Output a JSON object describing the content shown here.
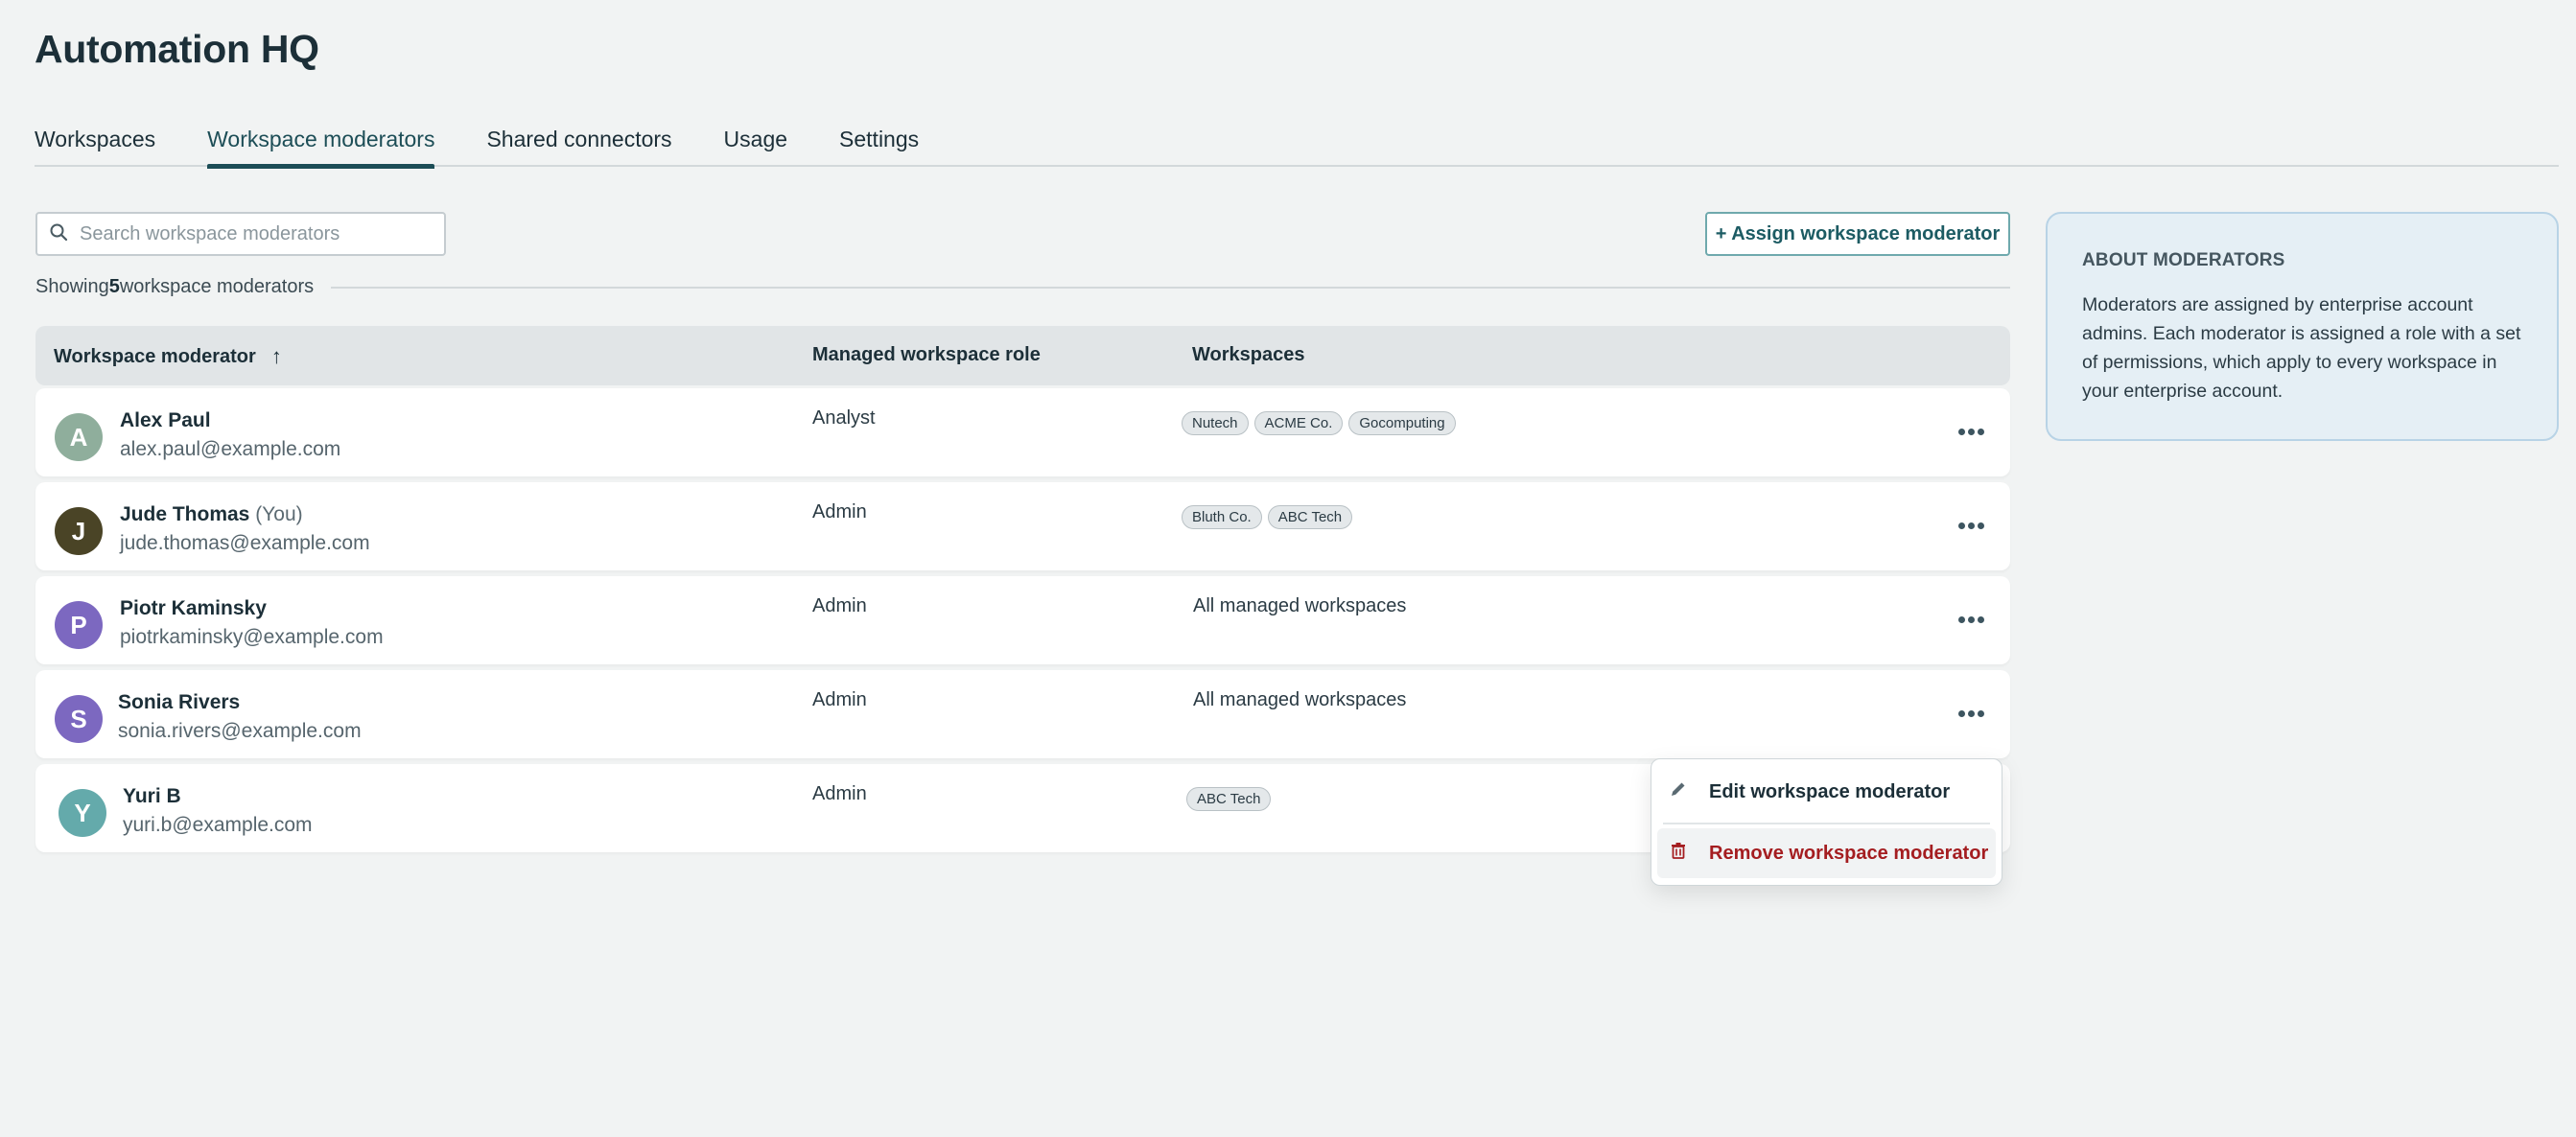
{
  "app": {
    "title": "Automation HQ"
  },
  "tabs": [
    {
      "label": "Workspaces",
      "active": false
    },
    {
      "label": "Workspace moderators",
      "active": true
    },
    {
      "label": "Shared connectors",
      "active": false
    },
    {
      "label": "Usage",
      "active": false
    },
    {
      "label": "Settings",
      "active": false
    }
  ],
  "toolbar": {
    "search_placeholder": "Search workspace moderators",
    "search_value": "",
    "assign_label": "+ Assign workspace moderator"
  },
  "summary": {
    "prefix": "Showing ",
    "count": "5",
    "suffix": " workspace moderators"
  },
  "table": {
    "columns": {
      "moderator": "Workspace moderator",
      "role": "Managed workspace role",
      "workspaces": "Workspaces"
    },
    "sort": {
      "column": "moderator",
      "direction": "ascending",
      "icon": "arrow-up-icon",
      "glyph": "↑"
    },
    "rows": [
      {
        "initial": "A",
        "avatar_color": "#8fae9c",
        "name": "Alex Paul",
        "you_label": "",
        "email": "alex.paul@example.com",
        "role": "Analyst",
        "workspaces": [
          "Nutech",
          "ACME Co.",
          "Gocomputing"
        ],
        "workspaces_text": ""
      },
      {
        "initial": "J",
        "avatar_color": "#4a4426",
        "name": "Jude Thomas",
        "you_label": "(You)",
        "email": "jude.thomas@example.com",
        "role": "Admin",
        "workspaces": [
          "Bluth Co.",
          "ABC Tech"
        ],
        "workspaces_text": ""
      },
      {
        "initial": "P",
        "avatar_color": "#7c68c0",
        "name": "Piotr Kaminsky",
        "you_label": "",
        "email": "piotrkaminsky@example.com",
        "role": "Admin",
        "workspaces": [],
        "workspaces_text": "All managed workspaces"
      },
      {
        "initial": "S",
        "avatar_color": "#7c68c0",
        "name": "Sonia Rivers",
        "you_label": "",
        "email": "sonia.rivers@example.com",
        "role": "Admin",
        "workspaces": [],
        "workspaces_text": "All managed workspaces"
      },
      {
        "initial": "Y",
        "avatar_color": "#64aaab",
        "name": "Yuri B",
        "you_label": "",
        "email": "yuri.b@example.com",
        "role": "Admin",
        "workspaces": [
          "ABC Tech"
        ],
        "workspaces_text": ""
      }
    ]
  },
  "context_menu": {
    "open_for_row": 3,
    "items": [
      {
        "label": "Edit workspace moderator",
        "icon": "pencil-icon",
        "color": "#1c2f38"
      },
      {
        "label": "Remove workspace moderator",
        "icon": "trash-icon",
        "color": "#a41d20"
      }
    ]
  },
  "info_panel": {
    "title": "ABOUT MODERATORS",
    "body": "Moderators are assigned by enterprise account admins. Each moderator is assigned a role with a set of permissions, which apply to every workspace in your enterprise account."
  },
  "colors": {
    "accent": "#1c4d56",
    "danger": "#a41d20",
    "info_bg": "#e5eff5"
  }
}
